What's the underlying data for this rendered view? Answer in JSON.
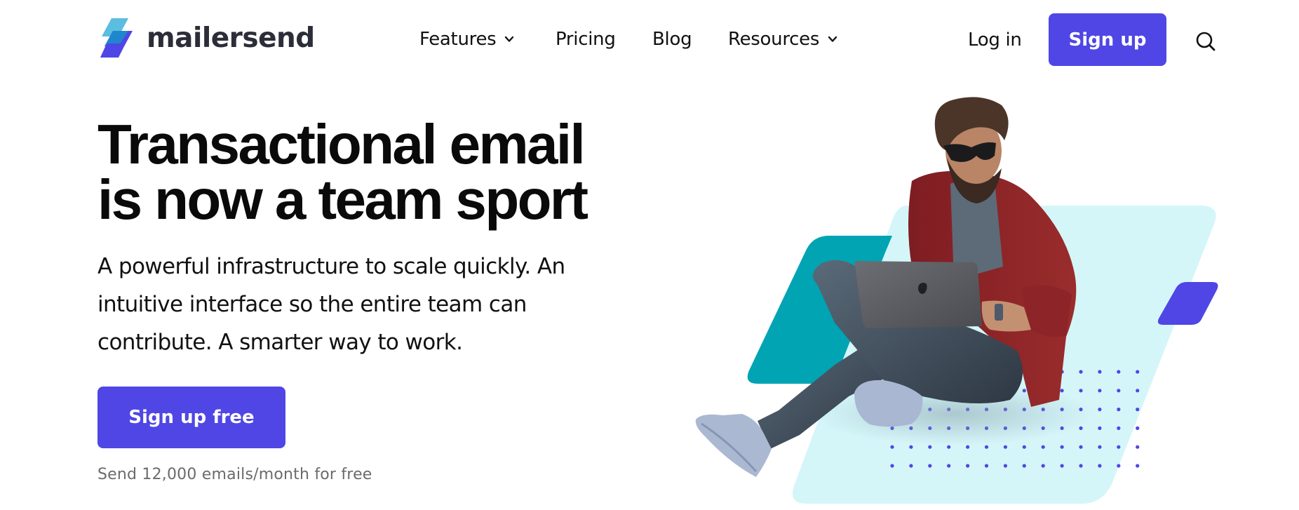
{
  "brand": {
    "name": "mailersend",
    "colors": {
      "primary": "#4f46e5",
      "logo_light_blue": "#5bbde0",
      "logo_mid_blue": "#1e88cc",
      "teal": "#00a4b3",
      "light_cyan": "#d4f6f9",
      "text_dark": "#0a0a0a",
      "muted": "#6b6b6b"
    }
  },
  "nav": {
    "items": [
      {
        "label": "Features",
        "has_dropdown": true,
        "icon": "chevron-down-icon"
      },
      {
        "label": "Pricing",
        "has_dropdown": false
      },
      {
        "label": "Blog",
        "has_dropdown": false
      },
      {
        "label": "Resources",
        "has_dropdown": true,
        "icon": "chevron-down-icon"
      }
    ],
    "login_label": "Log in",
    "signup_label": "Sign up",
    "search_icon": "search-icon"
  },
  "hero": {
    "headline_lines": [
      "Transactional email",
      "is now a team sport"
    ],
    "lede_lines": [
      "A powerful infrastructure to scale quickly. An",
      "intuitive interface so the entire team can",
      "contribute. A smarter way to work."
    ],
    "cta_label": "Sign up free",
    "cta_subtext": "Send 12,000 emails/month for free",
    "illustration": {
      "subject": "person sitting cross-legged working on a laptop",
      "decorations": [
        "teal-parallelogram",
        "light-cyan-parallelogram",
        "purple-parallelogram",
        "dot-grid"
      ]
    }
  }
}
